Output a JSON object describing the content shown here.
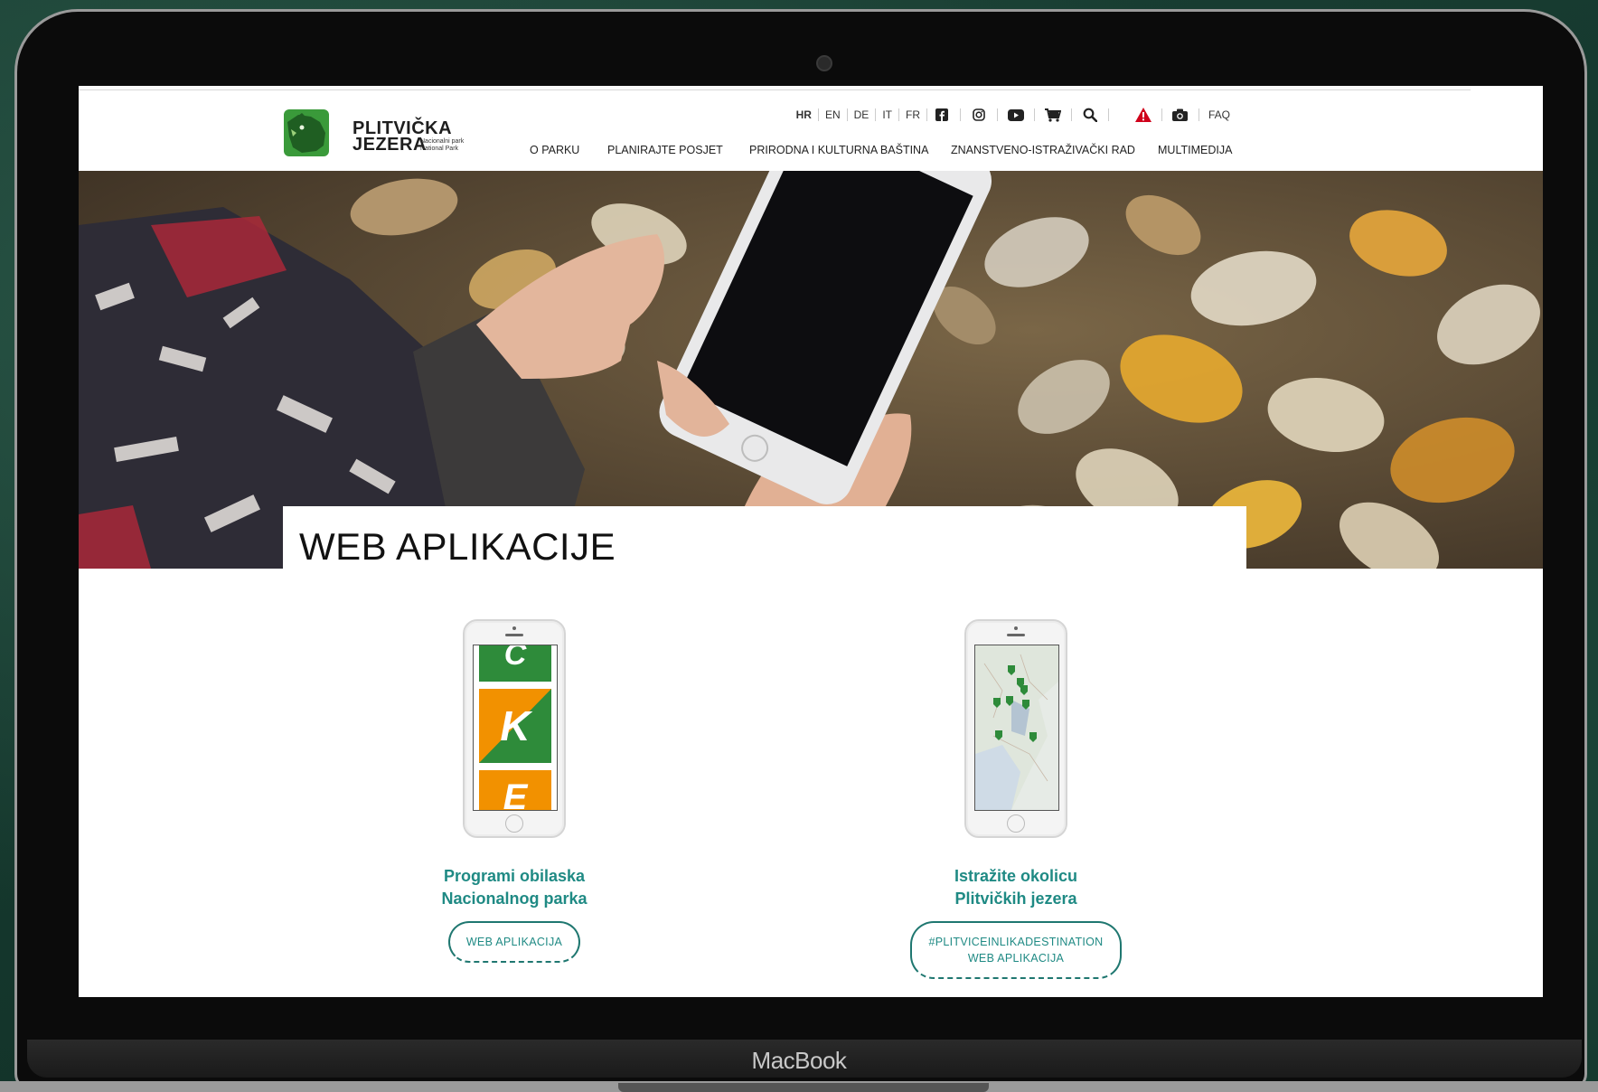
{
  "device": {
    "brand": "MacBook"
  },
  "site": {
    "logo": {
      "line1": "PLITVIČKA",
      "line2": "JEZERA",
      "sub1": "Nacionalni park",
      "sub2": "National Park"
    },
    "utility": {
      "languages": [
        "HR",
        "EN",
        "DE",
        "IT",
        "FR"
      ],
      "active_language": "HR",
      "icons": [
        "facebook-icon",
        "instagram-icon",
        "youtube-icon",
        "cart-icon",
        "search-icon",
        "alert-icon",
        "camera-icon"
      ],
      "faq": "FAQ"
    },
    "nav": [
      "O PARKU",
      "PLANIRAJTE POSJET",
      "PRIRODNA I KULTURNA BAŠTINA",
      "ZNANSTVENO-ISTRAŽIVAČKI RAD",
      "MULTIMEDIJA"
    ]
  },
  "page": {
    "title": "WEB APLIKACIJE",
    "cards": [
      {
        "title_line1": "Programi obilaska",
        "title_line2": "Nacionalnog parka",
        "button_lines": [
          "WEB APLIKACIJA"
        ],
        "screen_letters": [
          "C",
          "K",
          "E"
        ]
      },
      {
        "title_line1": "Istražite okolicu",
        "title_line2": "Plitvičkih jezera",
        "button_lines": [
          "#PLITVICEINLIKADESTINATION",
          "WEB APLIKACIJA"
        ]
      }
    ]
  },
  "colors": {
    "accent": "#1f8a84",
    "logo_green": "#3a9a3a",
    "alert": "#d0021b",
    "tile_green": "#2e8b3a",
    "tile_orange": "#f29100"
  }
}
